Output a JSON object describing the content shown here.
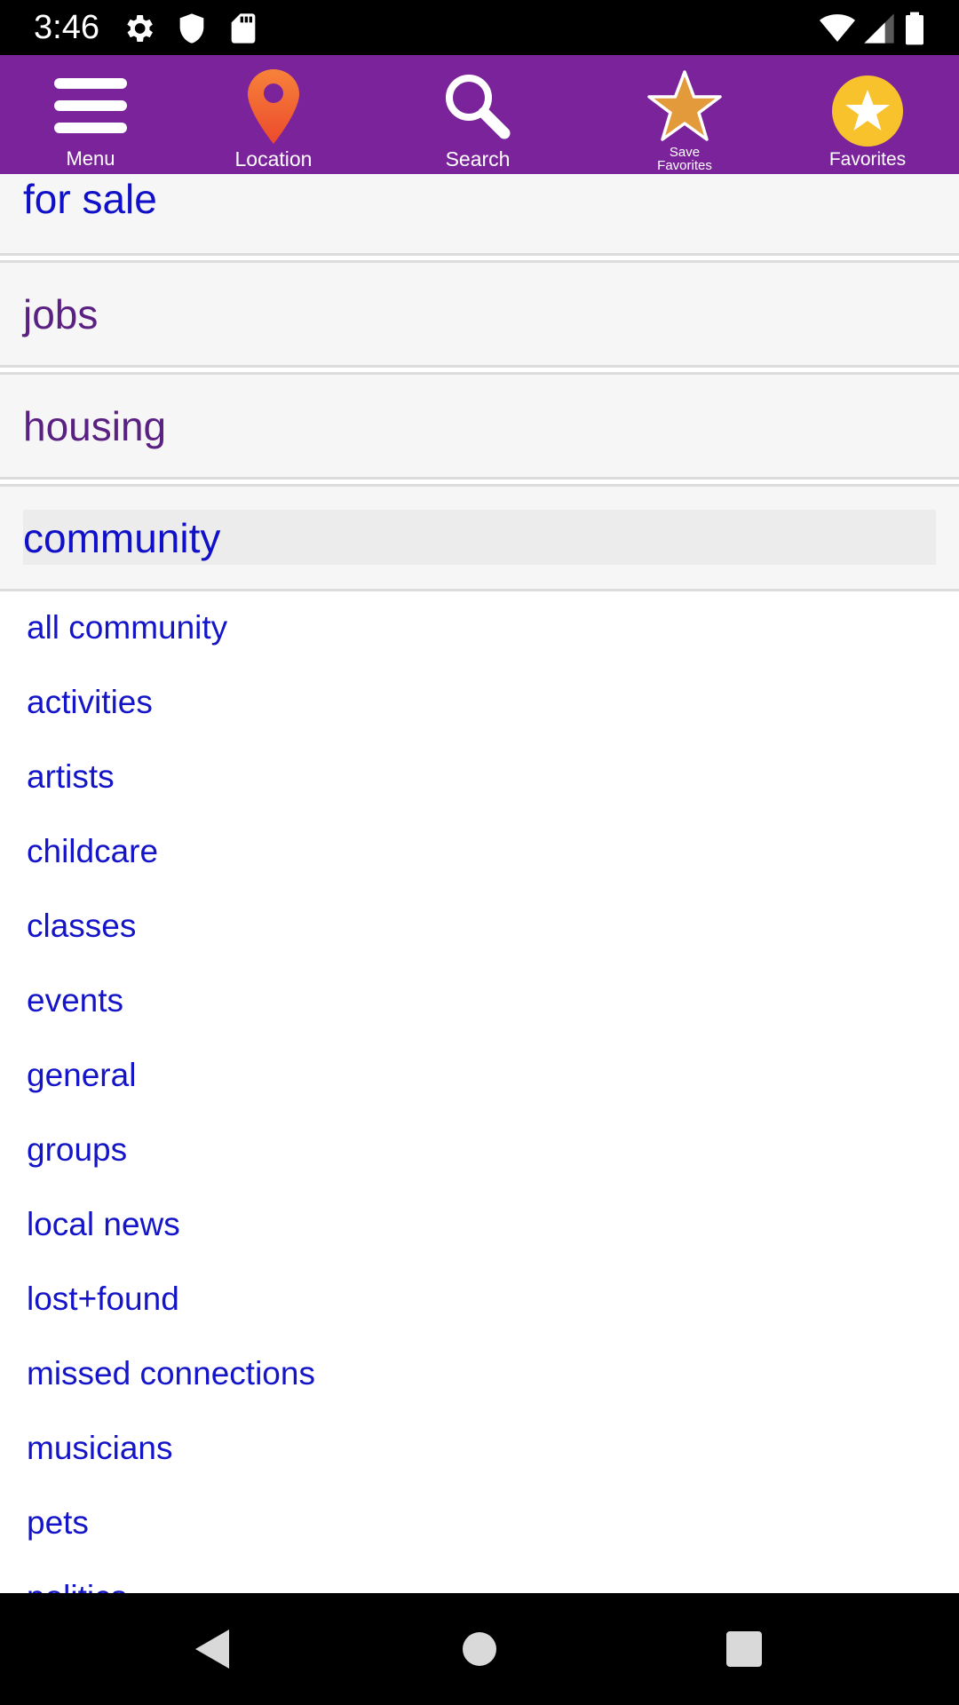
{
  "status_bar": {
    "time": "3:46",
    "icons": [
      "settings-icon",
      "shield-icon",
      "sd-card-icon",
      "wifi-icon",
      "signal-icon",
      "battery-icon"
    ]
  },
  "toolbar": {
    "background": "#7b239b",
    "menu_label": "Menu",
    "location_label": "Location",
    "search_label": "Search",
    "save_favorites_line1": "Save",
    "save_favorites_line2": "Favorites",
    "favorites_label": "Favorites"
  },
  "categories": {
    "for_sale": "for sale",
    "jobs": "jobs",
    "housing": "housing",
    "community": "community"
  },
  "community_items": [
    "all community",
    "activities",
    "artists",
    "childcare",
    "classes",
    "events",
    "general",
    "groups",
    "local news",
    "lost+found",
    "missed connections",
    "musicians",
    "pets",
    "politics"
  ],
  "colors": {
    "link": "#1414c8",
    "visited": "#5b2182",
    "toolbar": "#7b239b",
    "favorites_star": "#f8c22c",
    "save_star": "#e29a3a"
  }
}
